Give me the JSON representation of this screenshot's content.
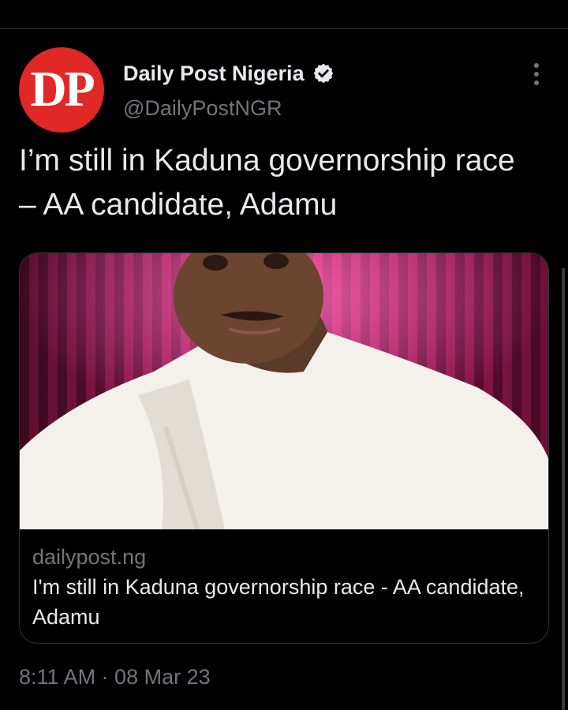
{
  "author": {
    "avatar_text": "DP",
    "display_name": "Daily Post Nigeria",
    "handle": "@DailyPostNGR",
    "brand_color": "#e02826",
    "verified_icon": "verified-badge-icon"
  },
  "tweet": {
    "text": "I’m still in Kaduna governorship race – AA candidate, Adamu",
    "timestamp": "8:11 AM · 08 Mar 23"
  },
  "link_card": {
    "domain": "dailypost.ng",
    "title": "I'm still in Kaduna governorship race - AA candidate, Adamu",
    "image_description_icon": "photo-thumbnail"
  },
  "colors": {
    "background": "#000000",
    "primary_text": "#e7e9ea",
    "secondary_text": "#71767b",
    "border": "#2f3336"
  }
}
